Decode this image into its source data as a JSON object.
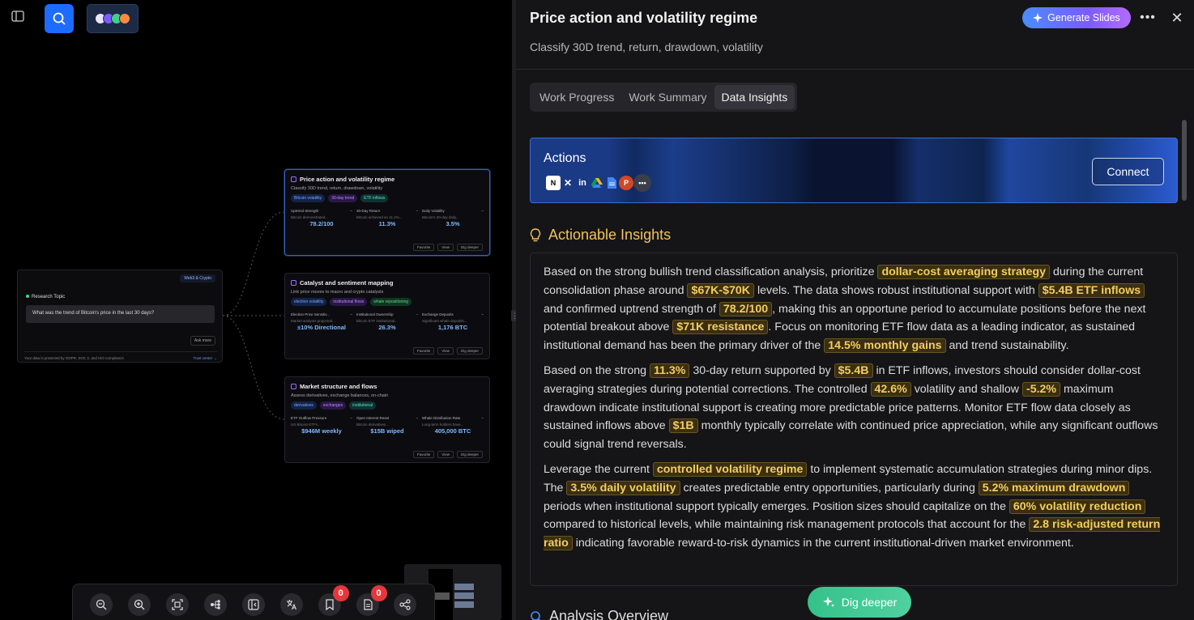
{
  "canvas": {
    "research_topic": {
      "tag": "Web3 & Crypto",
      "label": "Research Topic",
      "question": "What was the trend of Bitcoin's price in the last 30 days?",
      "ask_more": "Ask more",
      "compliance": "Your data is protected by GDPR, SOC 2, and ISO compliance",
      "trust_center": "Trust center →"
    },
    "nodes": [
      {
        "title": "Price action and volatility regime",
        "subtitle": "Classify 30D trend, return, drawdown, volatility",
        "tags": [
          "Bitcoin volatility",
          "30-day trend",
          "ETF inflows"
        ],
        "metrics": [
          {
            "label": "Uptrend Strength",
            "desc": "Bitcoin demonstrated...",
            "value": "78.2/100"
          },
          {
            "label": "30-Day Return",
            "desc": "Bitcoin achieved an 11.2%...",
            "value": "11.3%"
          },
          {
            "label": "Daily Volatility",
            "desc": "Bitcoin's 30-day daily...",
            "value": "3.5%"
          }
        ],
        "actions": [
          "Favorite",
          "View",
          "Dig deeper"
        ]
      },
      {
        "title": "Catalyst and sentiment mapping",
        "subtitle": "Link price moves to macro and crypto catalysts",
        "tags": [
          "election volatility",
          "institutional flows",
          "whale repositioning"
        ],
        "metrics": [
          {
            "label": "Election Price Sensitiv...",
            "desc": "Market analysts projected...",
            "value": "±10% Directional"
          },
          {
            "label": "Institutional Ownership",
            "desc": "Bitcoin ETF institutional...",
            "value": "26.3%"
          },
          {
            "label": "Exchange Deposits",
            "desc": "Significant whale deposits...",
            "value": "1,176 BTC"
          }
        ],
        "actions": [
          "Favorite",
          "View",
          "Dig deeper"
        ]
      },
      {
        "title": "Market structure and flows",
        "subtitle": "Assess derivatives, exchange balances, on-chain",
        "tags": [
          "derivatives",
          "exchanges",
          "institutional"
        ],
        "metrics": [
          {
            "label": "ETF Outflow Pressure",
            "desc": "US Bitcoin ETFs...",
            "value": "$946M weekly"
          },
          {
            "label": "Open Interest Reset",
            "desc": "Bitcoin derivatives...",
            "value": "$15B wiped"
          },
          {
            "label": "Whale Distribution Rate",
            "desc": "Long-term holders have...",
            "value": "405,000 BTC"
          }
        ],
        "actions": [
          "Favorite",
          "View",
          "Dig deeper"
        ]
      }
    ],
    "toolbar": {
      "bookmark_count": "0",
      "notes_count": "0"
    }
  },
  "panel": {
    "title": "Price action and volatility regime",
    "subtitle": "Classify 30D trend, return, drawdown, volatility",
    "generate_slides": "Generate Slides",
    "tabs": [
      "Work Progress",
      "Work Summary",
      "Data Insights"
    ],
    "active_tab": "Data Insights",
    "actions": {
      "title": "Actions",
      "connect": "Connect",
      "integrations": [
        "notion-icon",
        "x-icon",
        "linkedin-icon",
        "google-drive-icon",
        "google-docs-icon",
        "powerpoint-icon"
      ]
    },
    "insights_title": "Actionable Insights",
    "paragraphs": [
      [
        {
          "t": "Based on the strong bullish trend classification analysis, prioritize "
        },
        {
          "h": "dollar-cost averaging strategy"
        },
        {
          "t": " during the current consolidation phase around "
        },
        {
          "h": "$67K-$70K"
        },
        {
          "t": " levels. The data shows robust institutional support with "
        },
        {
          "h": "$5.4B ETF inflows"
        },
        {
          "t": " and confirmed uptrend strength of "
        },
        {
          "h": "78.2/100"
        },
        {
          "t": ", making this an opportune period to accumulate positions before the next potential breakout above "
        },
        {
          "h": "$71K resistance"
        },
        {
          "t": ". Focus on monitoring ETF flow data as a leading indicator, as sustained institutional demand has been the primary driver of the "
        },
        {
          "h": "14.5% monthly gains"
        },
        {
          "t": " and trend sustainability."
        }
      ],
      [
        {
          "t": "Based on the strong "
        },
        {
          "h": "11.3%"
        },
        {
          "t": " 30-day return supported by "
        },
        {
          "h": "$5.4B"
        },
        {
          "t": " in ETF inflows, investors should consider dollar-cost averaging strategies during potential corrections. The controlled "
        },
        {
          "h": "42.6%"
        },
        {
          "t": " volatility and shallow "
        },
        {
          "h": "-5.2%"
        },
        {
          "t": " maximum drawdown indicate institutional support is creating more predictable price patterns. Monitor ETF flow data closely as sustained inflows above "
        },
        {
          "h": "$1B"
        },
        {
          "t": " monthly typically correlate with continued price appreciation, while any significant outflows could signal trend reversals."
        }
      ],
      [
        {
          "t": "Leverage the current "
        },
        {
          "h": "controlled volatility regime"
        },
        {
          "t": " to implement systematic accumulation strategies during minor dips. The "
        },
        {
          "h": "3.5% daily volatility"
        },
        {
          "t": " creates predictable entry opportunities, particularly during "
        },
        {
          "h": "5.2% maximum drawdown"
        },
        {
          "t": " periods when institutional support typically emerges. Position sizes should capitalize on the "
        },
        {
          "h": "60% volatility reduction"
        },
        {
          "t": " compared to historical levels, while maintaining risk management protocols that account for the "
        },
        {
          "h": "2.8 risk-adjusted return ratio"
        },
        {
          "t": " indicating favorable reward-to-risk dynamics in the current institutional-driven market environment."
        }
      ]
    ],
    "overview_title": "Analysis Overview",
    "dig_deeper": "Dig deeper"
  }
}
